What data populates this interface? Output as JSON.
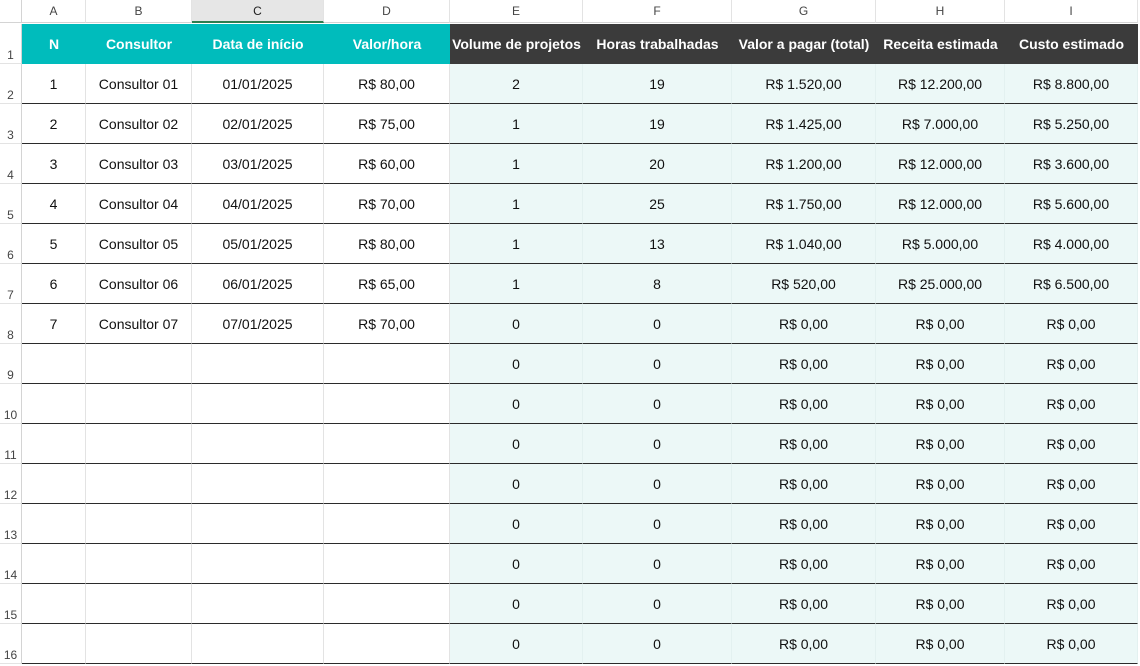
{
  "columns": [
    "A",
    "B",
    "C",
    "D",
    "E",
    "F",
    "G",
    "H",
    "I"
  ],
  "selected_column": "C",
  "row_numbers": [
    "1",
    "2",
    "3",
    "4",
    "5",
    "6",
    "7",
    "8",
    "9",
    "10",
    "11",
    "12",
    "13",
    "14",
    "15",
    "16"
  ],
  "headers": [
    "N",
    "Consultor",
    "Data de início",
    "Valor/hora",
    "Volume de projetos",
    "Horas trabalhadas",
    "Valor a pagar (total)",
    "Receita estimada",
    "Custo estimado"
  ],
  "rows": [
    [
      "1",
      "Consultor 01",
      "01/01/2025",
      "R$ 80,00",
      "2",
      "19",
      "R$ 1.520,00",
      "R$ 12.200,00",
      "R$ 8.800,00"
    ],
    [
      "2",
      "Consultor 02",
      "02/01/2025",
      "R$ 75,00",
      "1",
      "19",
      "R$ 1.425,00",
      "R$ 7.000,00",
      "R$ 5.250,00"
    ],
    [
      "3",
      "Consultor 03",
      "03/01/2025",
      "R$ 60,00",
      "1",
      "20",
      "R$ 1.200,00",
      "R$ 12.000,00",
      "R$ 3.600,00"
    ],
    [
      "4",
      "Consultor 04",
      "04/01/2025",
      "R$ 70,00",
      "1",
      "25",
      "R$ 1.750,00",
      "R$ 12.000,00",
      "R$ 5.600,00"
    ],
    [
      "5",
      "Consultor 05",
      "05/01/2025",
      "R$ 80,00",
      "1",
      "13",
      "R$ 1.040,00",
      "R$ 5.000,00",
      "R$ 4.000,00"
    ],
    [
      "6",
      "Consultor 06",
      "06/01/2025",
      "R$ 65,00",
      "1",
      "8",
      "R$ 520,00",
      "R$ 25.000,00",
      "R$ 6.500,00"
    ],
    [
      "7",
      "Consultor 07",
      "07/01/2025",
      "R$ 70,00",
      "0",
      "0",
      "R$ 0,00",
      "R$ 0,00",
      "R$ 0,00"
    ],
    [
      "",
      "",
      "",
      "",
      "0",
      "0",
      "R$ 0,00",
      "R$ 0,00",
      "R$ 0,00"
    ],
    [
      "",
      "",
      "",
      "",
      "0",
      "0",
      "R$ 0,00",
      "R$ 0,00",
      "R$ 0,00"
    ],
    [
      "",
      "",
      "",
      "",
      "0",
      "0",
      "R$ 0,00",
      "R$ 0,00",
      "R$ 0,00"
    ],
    [
      "",
      "",
      "",
      "",
      "0",
      "0",
      "R$ 0,00",
      "R$ 0,00",
      "R$ 0,00"
    ],
    [
      "",
      "",
      "",
      "",
      "0",
      "0",
      "R$ 0,00",
      "R$ 0,00",
      "R$ 0,00"
    ],
    [
      "",
      "",
      "",
      "",
      "0",
      "0",
      "R$ 0,00",
      "R$ 0,00",
      "R$ 0,00"
    ],
    [
      "",
      "",
      "",
      "",
      "0",
      "0",
      "R$ 0,00",
      "R$ 0,00",
      "R$ 0,00"
    ],
    [
      "",
      "",
      "",
      "",
      "0",
      "0",
      "R$ 0,00",
      "R$ 0,00",
      "R$ 0,00"
    ]
  ],
  "colors": {
    "input_header": "#00bcbc",
    "calc_header": "#3b3b3b",
    "calc_fill": "#ecf8f7"
  }
}
